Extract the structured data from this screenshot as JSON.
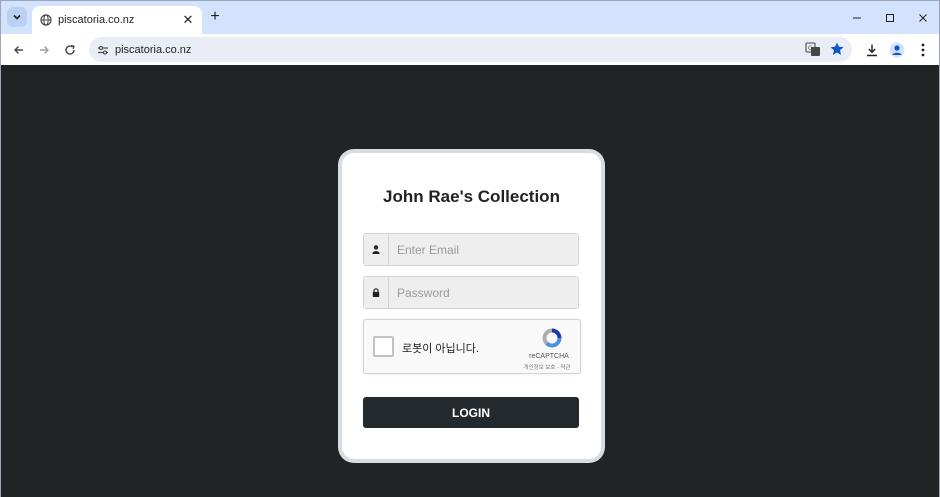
{
  "browser": {
    "tab_title": "piscatoria.co.nz",
    "url": "piscatoria.co.nz",
    "new_tab_symbol": "+",
    "close_symbol": "✕",
    "icons": {
      "tab_menu": "chevron-down-icon",
      "favicon": "globe-icon",
      "back": "arrow-left-icon",
      "forward": "arrow-right-icon",
      "reload": "reload-icon",
      "site_info": "tune-icon",
      "translate": "translate-icon",
      "bookmark": "star-icon",
      "download": "download-icon",
      "profile": "avatar-icon",
      "menu": "kebab-menu-icon"
    }
  },
  "login": {
    "title": "John Rae's Collection",
    "email_placeholder": "Enter Email",
    "email_value": "",
    "password_placeholder": "Password",
    "password_value": "",
    "button_label": "LOGIN",
    "icons": {
      "email": "user-icon",
      "password": "lock-icon"
    }
  },
  "recaptcha": {
    "label": "로봇이 아닙니다.",
    "brand": "reCAPTCHA",
    "terms": "개인정보 보호 - 약관"
  },
  "colors": {
    "page_background": "#202427",
    "tabbar": "#d3e3fd",
    "button": "#24292d",
    "bookmark_star": "#0b57d0"
  }
}
